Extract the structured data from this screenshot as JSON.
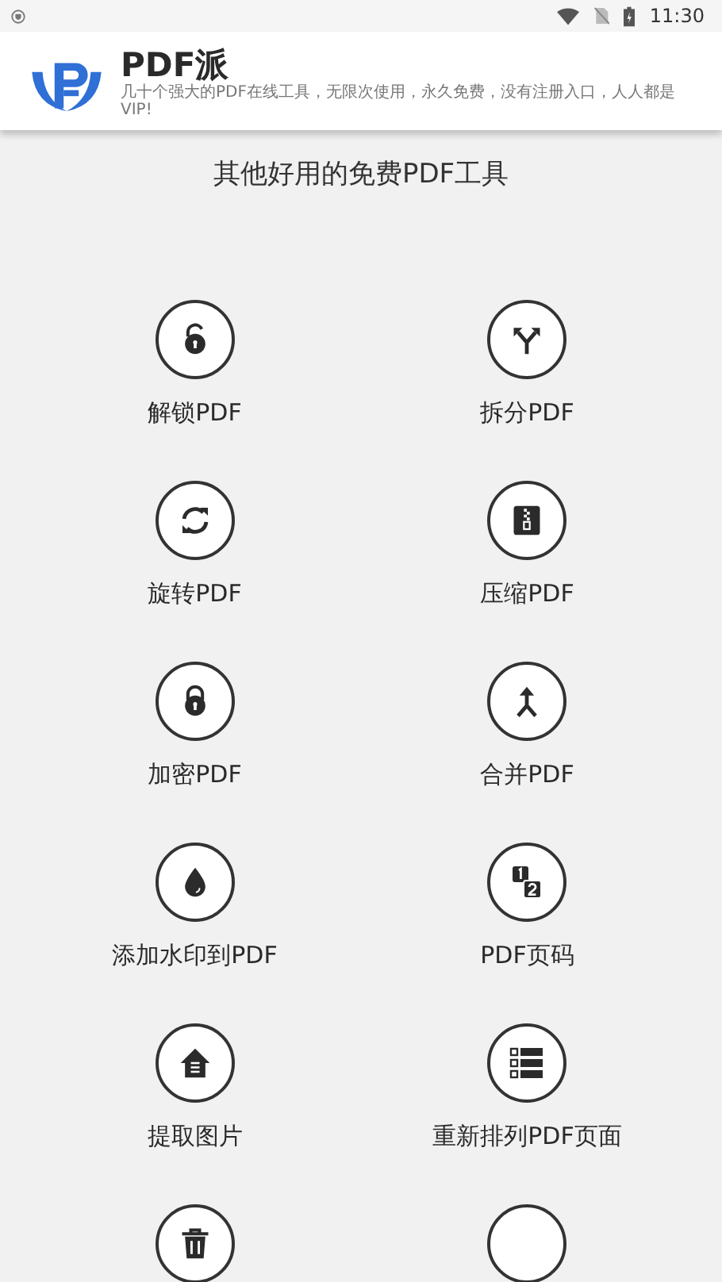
{
  "status_bar": {
    "time": "11:30"
  },
  "header": {
    "app_name": "PDF派",
    "tagline": "几十个强大的PDF在线工具，无限次使用，永久免费，没有注册入口，人人都是VIP!"
  },
  "section_title": "其他好用的免费PDF工具",
  "tools": [
    {
      "kind": "unlock",
      "label": "解锁PDF"
    },
    {
      "kind": "split",
      "label": "拆分PDF"
    },
    {
      "kind": "rotate",
      "label": "旋转PDF"
    },
    {
      "kind": "zip",
      "label": "压缩PDF"
    },
    {
      "kind": "lock",
      "label": "加密PDF"
    },
    {
      "kind": "merge",
      "label": "合并PDF"
    },
    {
      "kind": "drop",
      "label": "添加水印到PDF"
    },
    {
      "kind": "numbers",
      "label": "PDF页码"
    },
    {
      "kind": "house",
      "label": "提取图片"
    },
    {
      "kind": "list",
      "label": "重新排列PDF页面"
    },
    {
      "kind": "trash"
    },
    {
      "kind": "blank"
    }
  ]
}
